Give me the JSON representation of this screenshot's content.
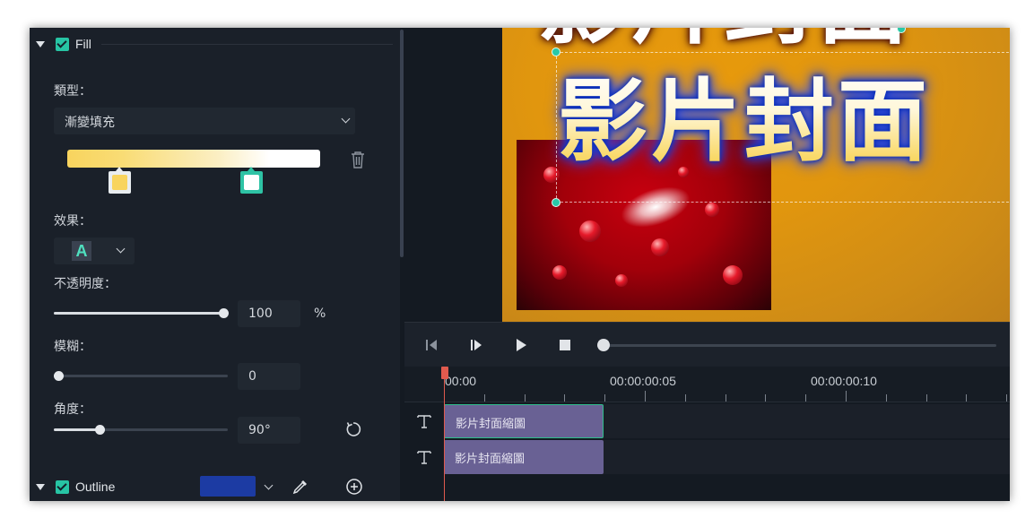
{
  "fill_section": {
    "title": "Fill",
    "type_label": "類型：",
    "type_value": "漸變填充",
    "effect_label": "效果：",
    "effect_glyph": "A",
    "opacity_label": "不透明度：",
    "opacity_value": "100",
    "opacity_unit": "%",
    "opacity_level": 1.0,
    "blur_label": "模糊：",
    "blur_value": "0",
    "blur_level": 0.0,
    "angle_label": "角度：",
    "angle_value": "90°",
    "angle_level": 0.25,
    "gradient_stops": [
      {
        "position": 0.2,
        "color": "#f8d45e"
      },
      {
        "position": 0.72,
        "color": "#ffffff"
      }
    ],
    "accent_color": "#27c4a4"
  },
  "outline_section": {
    "title": "Outline",
    "color": "#1c3ba3"
  },
  "preview": {
    "overlay_title": "影片封面",
    "top_title": "影片封面",
    "background_color": "#e1960e",
    "text_glow_color": "#0b2fb6"
  },
  "playback": {
    "progress": 0.0
  },
  "timeline": {
    "timecodes": [
      "00:00",
      "00:00:00:05",
      "00:00:00:10"
    ],
    "clips": [
      {
        "label": "影片封面縮圖",
        "selected": true
      },
      {
        "label": "影片封面縮圖",
        "selected": false
      }
    ],
    "clip_color": "#696194",
    "playhead_color": "#e05a4e"
  }
}
